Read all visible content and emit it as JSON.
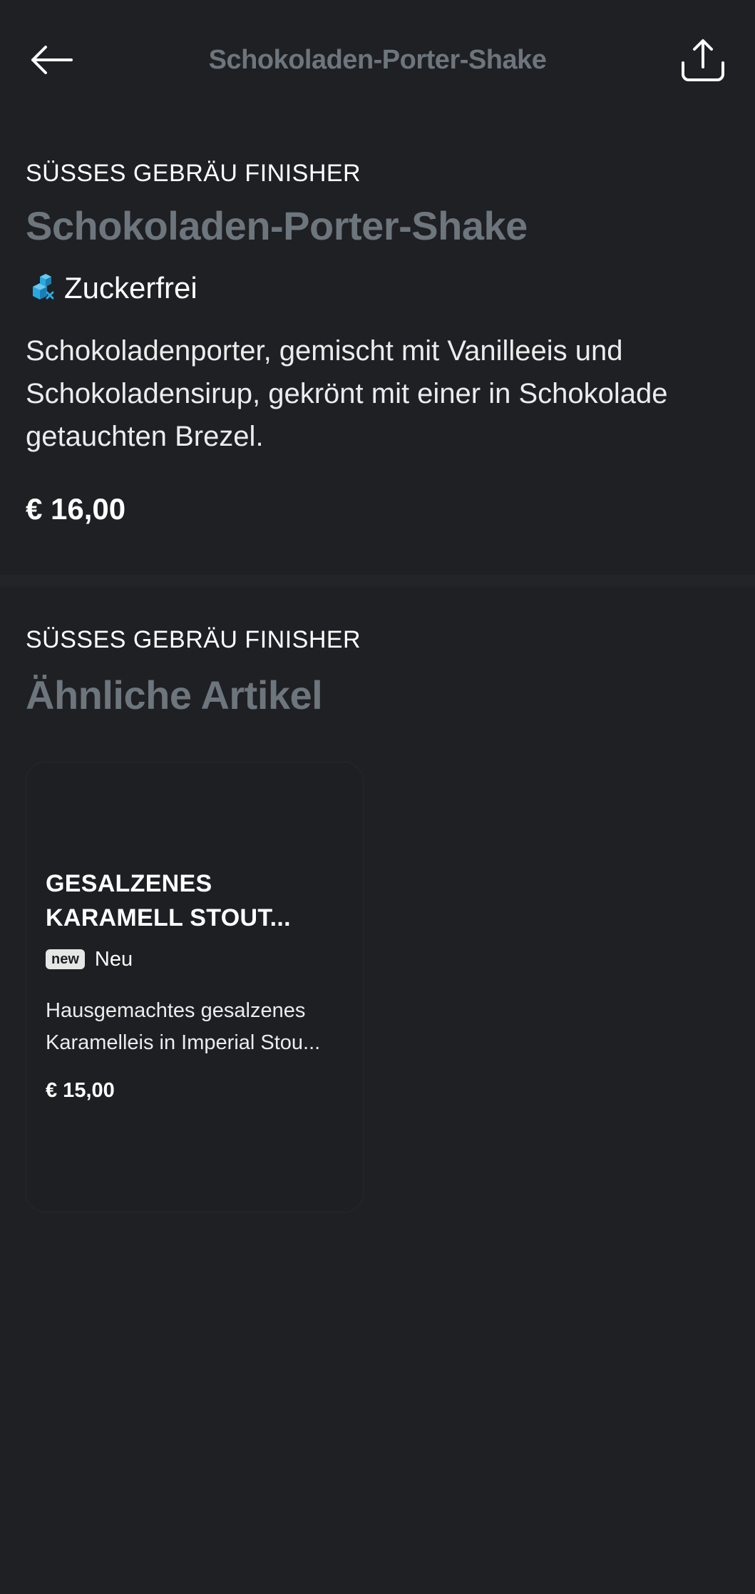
{
  "header": {
    "title": "Schokoladen-Porter-Shake",
    "back_icon": "arrow-left-icon",
    "share_icon": "share-icon"
  },
  "product": {
    "category": "SÜSSES GEBRÄU FINISHER",
    "name": "Schokoladen-Porter-Shake",
    "diet_icon": "sugar-free-icon",
    "diet_label": "Zuckerfrei",
    "description": "Schokoladenporter, gemischt mit Vanilleeis und Schokoladensirup, gekrönt mit einer in Schokolade getauchten Brezel.",
    "price": "€ 16,00"
  },
  "similar": {
    "category": "SÜSSES GEBRÄU FINISHER",
    "title": "Ähnliche Artikel",
    "items": [
      {
        "title": "GESALZENES KARAMELL STOUT...",
        "badge": "new",
        "badge_label": "Neu",
        "description": "Hausgemachtes gesalzenes Karamelleis in Imperial Stou...",
        "price": "€ 15,00"
      }
    ]
  },
  "colors": {
    "background": "#1f2024",
    "title_gray": "#6d757d",
    "diet_icon_blue": "#29a9e1"
  }
}
